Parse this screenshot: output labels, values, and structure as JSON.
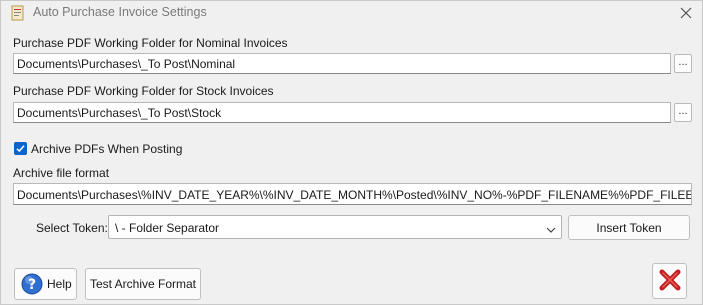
{
  "window": {
    "title": "Auto Purchase Invoice Settings",
    "accent_color": "#0a63c9"
  },
  "nominal": {
    "label": "Purchase PDF Working Folder for Nominal Invoices",
    "value": "Documents\\Purchases\\_To Post\\Nominal",
    "browse_label": "..."
  },
  "stock": {
    "label": "Purchase PDF Working Folder for Stock Invoices",
    "value": "Documents\\Purchases\\_To Post\\Stock",
    "browse_label": "..."
  },
  "archive": {
    "checkbox_label": "Archive PDFs When Posting",
    "checked": true,
    "format_label": "Archive file format",
    "format_value": "Documents\\Purchases\\%INV_DATE_YEAR%\\%INV_DATE_MONTH%\\Posted\\%INV_NO%-%PDF_FILENAME%%PDF_FILEEXT%"
  },
  "token": {
    "label": "Select Token:",
    "selected": "\\ - Folder Separator",
    "insert_label": "Insert Token"
  },
  "footer": {
    "help_label": "Help",
    "test_label": "Test Archive Format",
    "cancel_icon": "red-x-icon"
  }
}
